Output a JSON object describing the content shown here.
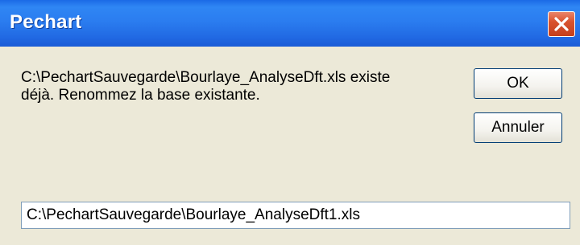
{
  "window": {
    "title": "Pechart"
  },
  "message": {
    "text": "C:\\PechartSauvegarde\\Bourlaye_AnalyseDft.xls existe\ndéjà. Renommez la base existante."
  },
  "buttons": {
    "ok_label": "OK",
    "cancel_label": "Annuler"
  },
  "path_field": {
    "value": "C:\\PechartSauvegarde\\Bourlaye_AnalyseDft1.xls"
  },
  "colors": {
    "titlebar": "#2B7DF0",
    "close_button": "#D9532F",
    "dialog_background": "#ECE9D8"
  },
  "icons": {
    "close": "close-icon"
  }
}
